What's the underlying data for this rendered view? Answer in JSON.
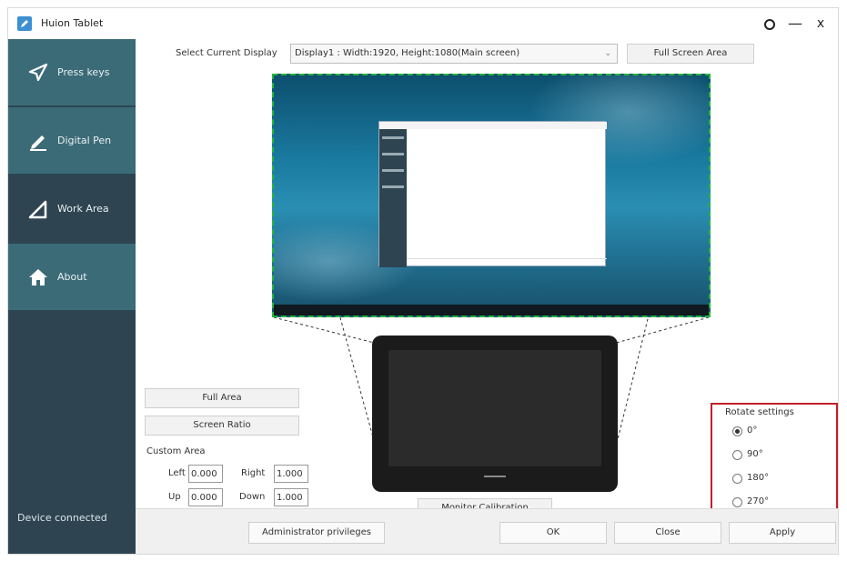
{
  "titlebar": {
    "title": "Huion Tablet",
    "buttons": {
      "settings_icon": "circle-icon",
      "minimize": "—",
      "close": "x"
    }
  },
  "sidebar": {
    "items": [
      {
        "label": "Press keys",
        "icon": "send-arrow-icon",
        "active": false
      },
      {
        "label": "Digital Pen",
        "icon": "pen-icon",
        "active": false
      },
      {
        "label": "Work Area",
        "icon": "triangle-icon",
        "active": true
      },
      {
        "label": "About",
        "icon": "home-icon",
        "active": false
      }
    ],
    "status": "Device connected"
  },
  "display": {
    "label": "Select Current Display",
    "selected": "Display1 : Width:1920, Height:1080(Main screen)",
    "full_screen_button": "Full Screen Area"
  },
  "area": {
    "full_area_button": "Full Area",
    "screen_ratio_button": "Screen Ratio",
    "custom_area_title": "Custom Area",
    "left_label": "Left",
    "left_value": "0.000",
    "right_label": "Right",
    "right_value": "1.000",
    "up_label": "Up",
    "up_value": "0.000",
    "down_label": "Down",
    "down_value": "1.000"
  },
  "calibration_button": "Monitor Calibration",
  "rotate": {
    "title": "Rotate settings",
    "options": [
      "0°",
      "90°",
      "180°",
      "270°"
    ],
    "selected": "0°"
  },
  "footer": {
    "admin": "Administrator privileges",
    "ok": "OK",
    "close": "Close",
    "apply": "Apply"
  },
  "colors": {
    "sidebar": "#3c6b78",
    "sidebar_active": "#2e4451",
    "highlight_border": "#c0202a",
    "area_dash": "#1fb63c"
  }
}
